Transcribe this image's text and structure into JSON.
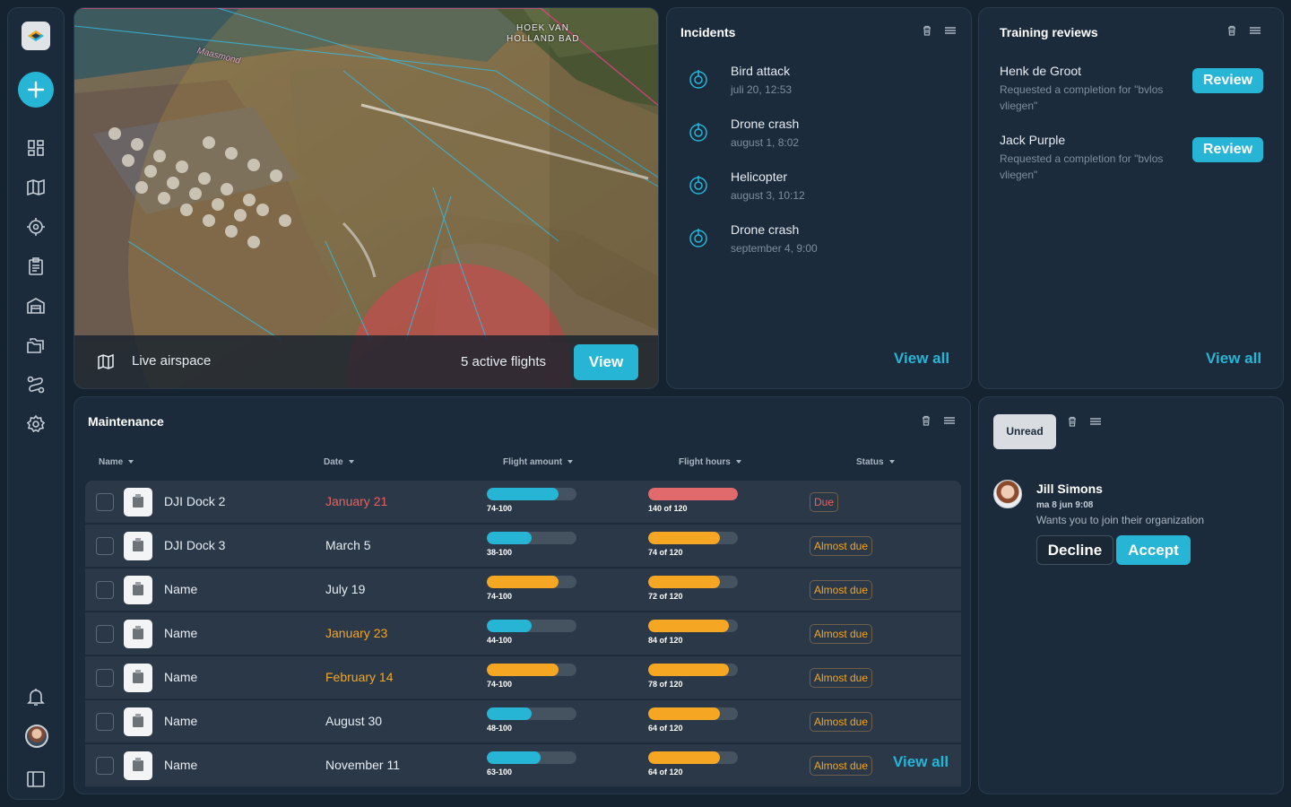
{
  "sidebar": {
    "logo": "app-logo",
    "add_label": "+",
    "nav": [
      "dashboard-icon",
      "map-icon",
      "target-icon",
      "clipboard-icon",
      "hangar-icon",
      "folders-icon",
      "route-icon",
      "settings-icon"
    ],
    "bottom": [
      "bell-icon",
      "user-avatar",
      "panel-toggle-icon"
    ]
  },
  "map": {
    "labels": {
      "town": "HOEK VAN",
      "town2": "HOLLAND BAD",
      "river": "Maasmond"
    },
    "live_label": "Live airspace",
    "active_flights": "5 active flights",
    "view_label": "View"
  },
  "incidents": {
    "title": "Incidents",
    "items": [
      {
        "title": "Bird attack",
        "date": "juli 20, 12:53"
      },
      {
        "title": "Drone crash",
        "date": "august 1, 8:02"
      },
      {
        "title": "Helicopter",
        "date": "august 3, 10:12"
      },
      {
        "title": "Drone crash",
        "date": "september 4, 9:00"
      }
    ],
    "view_all": "View all"
  },
  "training": {
    "title": "Training reviews",
    "items": [
      {
        "name": "Henk de Groot",
        "desc": "Requested a completion for \"bvlos vliegen\"",
        "button": "Review"
      },
      {
        "name": "Jack Purple",
        "desc": "Requested a completion for \"bvlos vliegen\"",
        "button": "Review"
      }
    ],
    "view_all": "View all"
  },
  "maintenance": {
    "title": "Maintenance",
    "columns": [
      "Name",
      "Date",
      "Flight amount",
      "Flight hours",
      "Status"
    ],
    "rows": [
      {
        "name": "DJI Dock 2",
        "date": "January 21",
        "date_color": "#e8615e",
        "amount_label": "74-100",
        "amount_frac": 0.8,
        "amount_color": "#27b5d6",
        "hours_label": "140 of 120",
        "hours_frac": 1.0,
        "hours_color": "#e06a6c",
        "status": "Due",
        "status_color": "#e8615e"
      },
      {
        "name": "DJI Dock 3",
        "date": "March 5",
        "date_color": "#e6ecf2",
        "amount_label": "38-100",
        "amount_frac": 0.5,
        "amount_color": "#27b5d6",
        "hours_label": "74 of 120",
        "hours_frac": 0.8,
        "hours_color": "#f5a623",
        "status": "Almost due",
        "status_color": "#f5a623"
      },
      {
        "name": "Name",
        "date": "July 19",
        "date_color": "#e6ecf2",
        "amount_label": "74-100",
        "amount_frac": 0.8,
        "amount_color": "#f5a623",
        "hours_label": "72 of 120",
        "hours_frac": 0.8,
        "hours_color": "#f5a623",
        "status": "Almost due",
        "status_color": "#f5a623"
      },
      {
        "name": "Name",
        "date": "January 23",
        "date_color": "#f5a623",
        "amount_label": "44-100",
        "amount_frac": 0.5,
        "amount_color": "#27b5d6",
        "hours_label": "84 of 120",
        "hours_frac": 0.9,
        "hours_color": "#f5a623",
        "status": "Almost due",
        "status_color": "#f5a623"
      },
      {
        "name": "Name",
        "date": "February 14",
        "date_color": "#f5a623",
        "amount_label": "74-100",
        "amount_frac": 0.8,
        "amount_color": "#f5a623",
        "hours_label": "78 of 120",
        "hours_frac": 0.9,
        "hours_color": "#f5a623",
        "status": "Almost due",
        "status_color": "#f5a623"
      },
      {
        "name": "Name",
        "date": "August 30",
        "date_color": "#e6ecf2",
        "amount_label": "48-100",
        "amount_frac": 0.5,
        "amount_color": "#27b5d6",
        "hours_label": "64 of 120",
        "hours_frac": 0.8,
        "hours_color": "#f5a623",
        "status": "Almost due",
        "status_color": "#f5a623"
      },
      {
        "name": "Name",
        "date": "November 11",
        "date_color": "#e6ecf2",
        "amount_label": "63-100",
        "amount_frac": 0.6,
        "amount_color": "#27b5d6",
        "hours_label": "64 of 120",
        "hours_frac": 0.8,
        "hours_color": "#f5a623",
        "status": "Almost due",
        "status_color": "#f5a623"
      }
    ],
    "view_all": "View all"
  },
  "notifications": {
    "filter_label": "Unread",
    "item": {
      "name": "Jill Simons",
      "time": "ma 8 jun 9:08",
      "message": "Wants you to join their organization",
      "decline": "Decline",
      "accept": "Accept"
    }
  },
  "colors": {
    "accent": "#27b5d6",
    "warning": "#f5a623",
    "danger": "#e8615e",
    "panel": "#1c2b3b",
    "background": "#152230"
  }
}
